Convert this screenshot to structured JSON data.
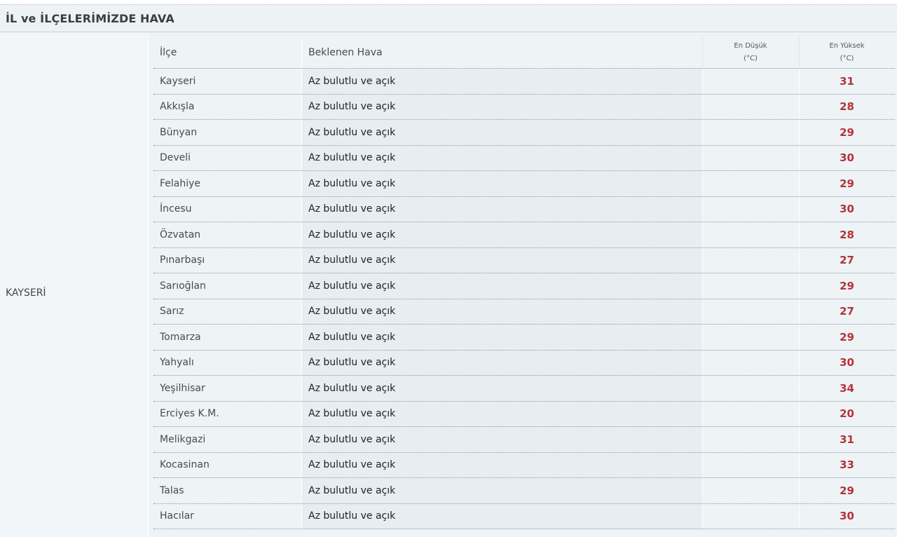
{
  "header": {
    "title": "İL ve İLÇELERİMİZDE HAVA"
  },
  "province": "KAYSERİ",
  "table": {
    "columns": {
      "ilce": "İlçe",
      "hava": "Beklenen Hava",
      "min_line1": "En Düşük",
      "min_line2": "(°C)",
      "max_line1": "En Yüksek",
      "max_line2": "(°C)"
    },
    "rows": [
      {
        "ilce": "Kayseri",
        "hava": "Az bulutlu ve açık",
        "min": "",
        "max": "31"
      },
      {
        "ilce": "Akkışla",
        "hava": "Az bulutlu ve açık",
        "min": "",
        "max": "28"
      },
      {
        "ilce": "Bünyan",
        "hava": "Az bulutlu ve açık",
        "min": "",
        "max": "29"
      },
      {
        "ilce": "Develi",
        "hava": "Az bulutlu ve açık",
        "min": "",
        "max": "30"
      },
      {
        "ilce": "Felahiye",
        "hava": "Az bulutlu ve açık",
        "min": "",
        "max": "29"
      },
      {
        "ilce": "İncesu",
        "hava": "Az bulutlu ve açık",
        "min": "",
        "max": "30"
      },
      {
        "ilce": "Özvatan",
        "hava": "Az bulutlu ve açık",
        "min": "",
        "max": "28"
      },
      {
        "ilce": "Pınarbaşı",
        "hava": "Az bulutlu ve açık",
        "min": "",
        "max": "27"
      },
      {
        "ilce": "Sarıoğlan",
        "hava": "Az bulutlu ve açık",
        "min": "",
        "max": "29"
      },
      {
        "ilce": "Sarız",
        "hava": "Az bulutlu ve açık",
        "min": "",
        "max": "27"
      },
      {
        "ilce": "Tomarza",
        "hava": "Az bulutlu ve açık",
        "min": "",
        "max": "29"
      },
      {
        "ilce": "Yahyalı",
        "hava": "Az bulutlu ve açık",
        "min": "",
        "max": "30"
      },
      {
        "ilce": "Yeşilhisar",
        "hava": "Az bulutlu ve açık",
        "min": "",
        "max": "34"
      },
      {
        "ilce": "Erciyes K.M.",
        "hava": "Az bulutlu ve açık",
        "min": "",
        "max": "20"
      },
      {
        "ilce": "Melikgazi",
        "hava": "Az bulutlu ve açık",
        "min": "",
        "max": "31"
      },
      {
        "ilce": "Kocasinan",
        "hava": "Az bulutlu ve açık",
        "min": "",
        "max": "33"
      },
      {
        "ilce": "Talas",
        "hava": "Az bulutlu ve açık",
        "min": "",
        "max": "29"
      },
      {
        "ilce": "Hacılar",
        "hava": "Az bulutlu ve açık",
        "min": "",
        "max": "30"
      }
    ]
  },
  "colors": {
    "max_temp": "#b5333b",
    "panel_bg": "#eef3f6"
  }
}
